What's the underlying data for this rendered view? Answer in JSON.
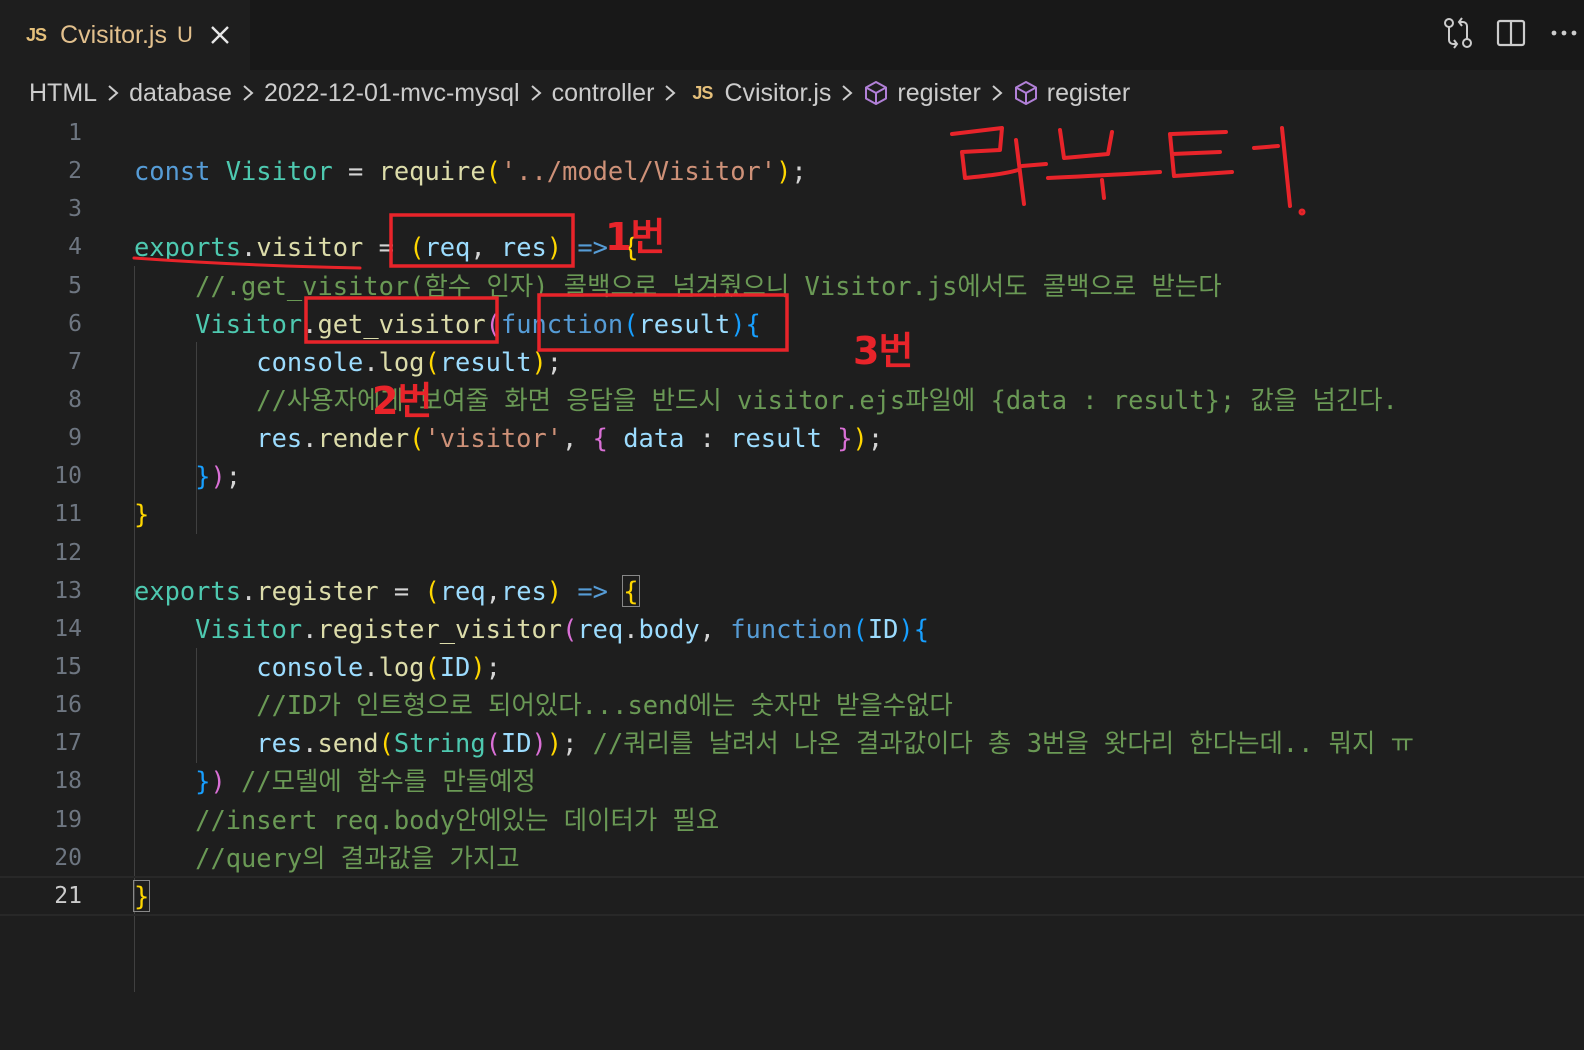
{
  "tab": {
    "badge": "JS",
    "filename": "Cvisitor.js",
    "modified": "U"
  },
  "breadcrumb": {
    "items": [
      "HTML",
      "database",
      "2022-12-01-mvc-mysql",
      "controller"
    ],
    "file_badge": "JS",
    "file": "Cvisitor.js",
    "symbol1": "register",
    "symbol2": "register"
  },
  "editor": {
    "line_numbers": [
      "1",
      "2",
      "3",
      "4",
      "5",
      "6",
      "7",
      "8",
      "9",
      "10",
      "11",
      "12",
      "13",
      "14",
      "15",
      "16",
      "17",
      "18",
      "19",
      "20",
      "21"
    ],
    "active_line": "21"
  },
  "annotations": {
    "label_1": "1번",
    "label_2": "2번",
    "label_3": "3번",
    "handwriting": "라우터"
  },
  "colors": {
    "background": "#1e1e1e",
    "keyword": "#569cd6",
    "comment": "#6a9955",
    "string": "#ce9178",
    "annotation_red": "#e8242a"
  },
  "icons": [
    "js-file-icon",
    "close-icon",
    "compare-changes-icon",
    "split-editor-icon",
    "more-actions-icon",
    "chevron-right-icon",
    "symbol-method-icon"
  ]
}
